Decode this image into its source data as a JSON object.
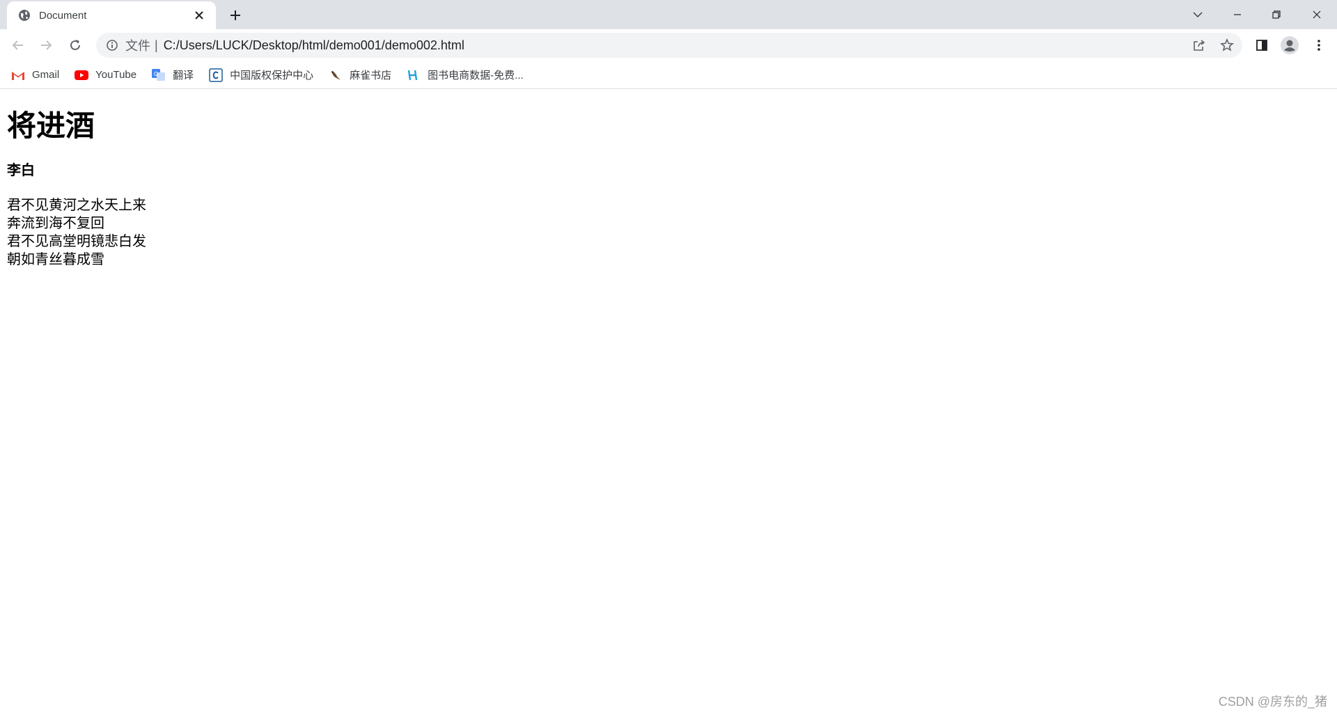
{
  "tab": {
    "title": "Document",
    "favicon": "globe-icon"
  },
  "address_bar": {
    "scheme_label": "文件",
    "separator": "|",
    "url": "C:/Users/LUCK/Desktop/html/demo001/demo002.html"
  },
  "bookmarks": [
    {
      "label": "Gmail",
      "icon": "gmail-icon"
    },
    {
      "label": "YouTube",
      "icon": "youtube-icon"
    },
    {
      "label": "翻译",
      "icon": "translate-icon"
    },
    {
      "label": "中国版权保护中心",
      "icon": "copyright-center-icon"
    },
    {
      "label": "麻雀书店",
      "icon": "sparrow-bookstore-icon"
    },
    {
      "label": "图书电商数据-免费...",
      "icon": "book-data-icon"
    }
  ],
  "page": {
    "title": "将进酒",
    "author": "李白",
    "lines": [
      "君不见黄河之水天上来",
      "奔流到海不复回",
      "君不见高堂明镜悲白发",
      "朝如青丝暮成雪"
    ]
  },
  "watermark": "CSDN @房东的_猪",
  "colors": {
    "tabstrip_bg": "#dee1e6",
    "omnibox_bg": "#f1f3f4",
    "youtube_red": "#ff0000",
    "gmail_red": "#ea4335",
    "translate_blue": "#4285f4",
    "text": "#000000"
  }
}
